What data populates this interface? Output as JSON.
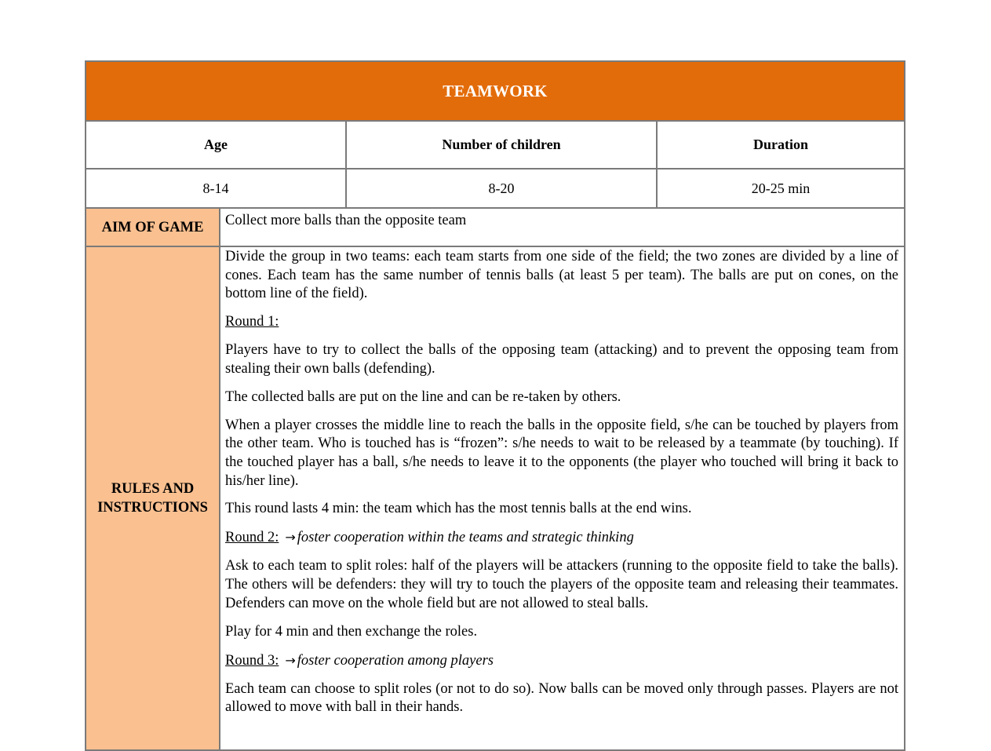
{
  "card": {
    "title": "TEAMWORK",
    "colors": {
      "title_bg": "#e36c0a",
      "label_bg": "#fac090",
      "border": "#7a7a7a"
    },
    "info_headers": [
      "Age",
      "Number of children",
      "Duration"
    ],
    "info_values": [
      "8-14",
      "8-20",
      "20-25 min"
    ],
    "aim": {
      "label": "AIM OF GAME",
      "text": "Collect more balls than the opposite team"
    },
    "rules": {
      "label_line1": "RULES AND",
      "label_line2": "INSTRUCTIONS",
      "intro": "Divide the group in two teams: each team starts from one side of the field; the two zones are divided by a line of cones. Each team has the same number of tennis balls (at least 5 per team). The balls are put on cones, on the bottom line of the field).",
      "round1": {
        "heading": "Round 1:",
        "paragraphs": [
          "Players have to try to collect the balls of the opposing team (attacking) and to prevent the opposing team from stealing their own balls (defending).",
          "The collected balls are put on the line and can be re-taken by others.",
          "When a player crosses the middle line to reach the balls in the opposite field, s/he can be touched by players from the other team. Who is touched has is “frozen”: s/he needs to wait to be released by a teammate (by touching). If the touched player has a ball, s/he needs to leave it to the opponents (the player who touched will bring it back to his/her line).",
          "This round lasts 4 min: the team which has the most tennis balls at the end wins."
        ]
      },
      "round2": {
        "heading": "Round 2:",
        "arrow": "→",
        "goal": "foster cooperation within the teams and strategic thinking",
        "paragraphs": [
          "Ask to each team to split roles: half of the players will be attackers (running to the opposite field to take the balls). The others will be defenders: they will try to touch the players of the opposite team and releasing their teammates. Defenders can move on the whole field but are not allowed to steal balls.",
          "Play for 4 min and then exchange the roles."
        ]
      },
      "round3": {
        "heading": "Round 3:",
        "arrow": "→",
        "goal": "foster cooperation among players",
        "paragraphs": [
          "Each team can choose to split roles (or not to do so). Now balls can be moved only through passes. Players are not allowed to move with ball in their hands."
        ]
      }
    }
  }
}
